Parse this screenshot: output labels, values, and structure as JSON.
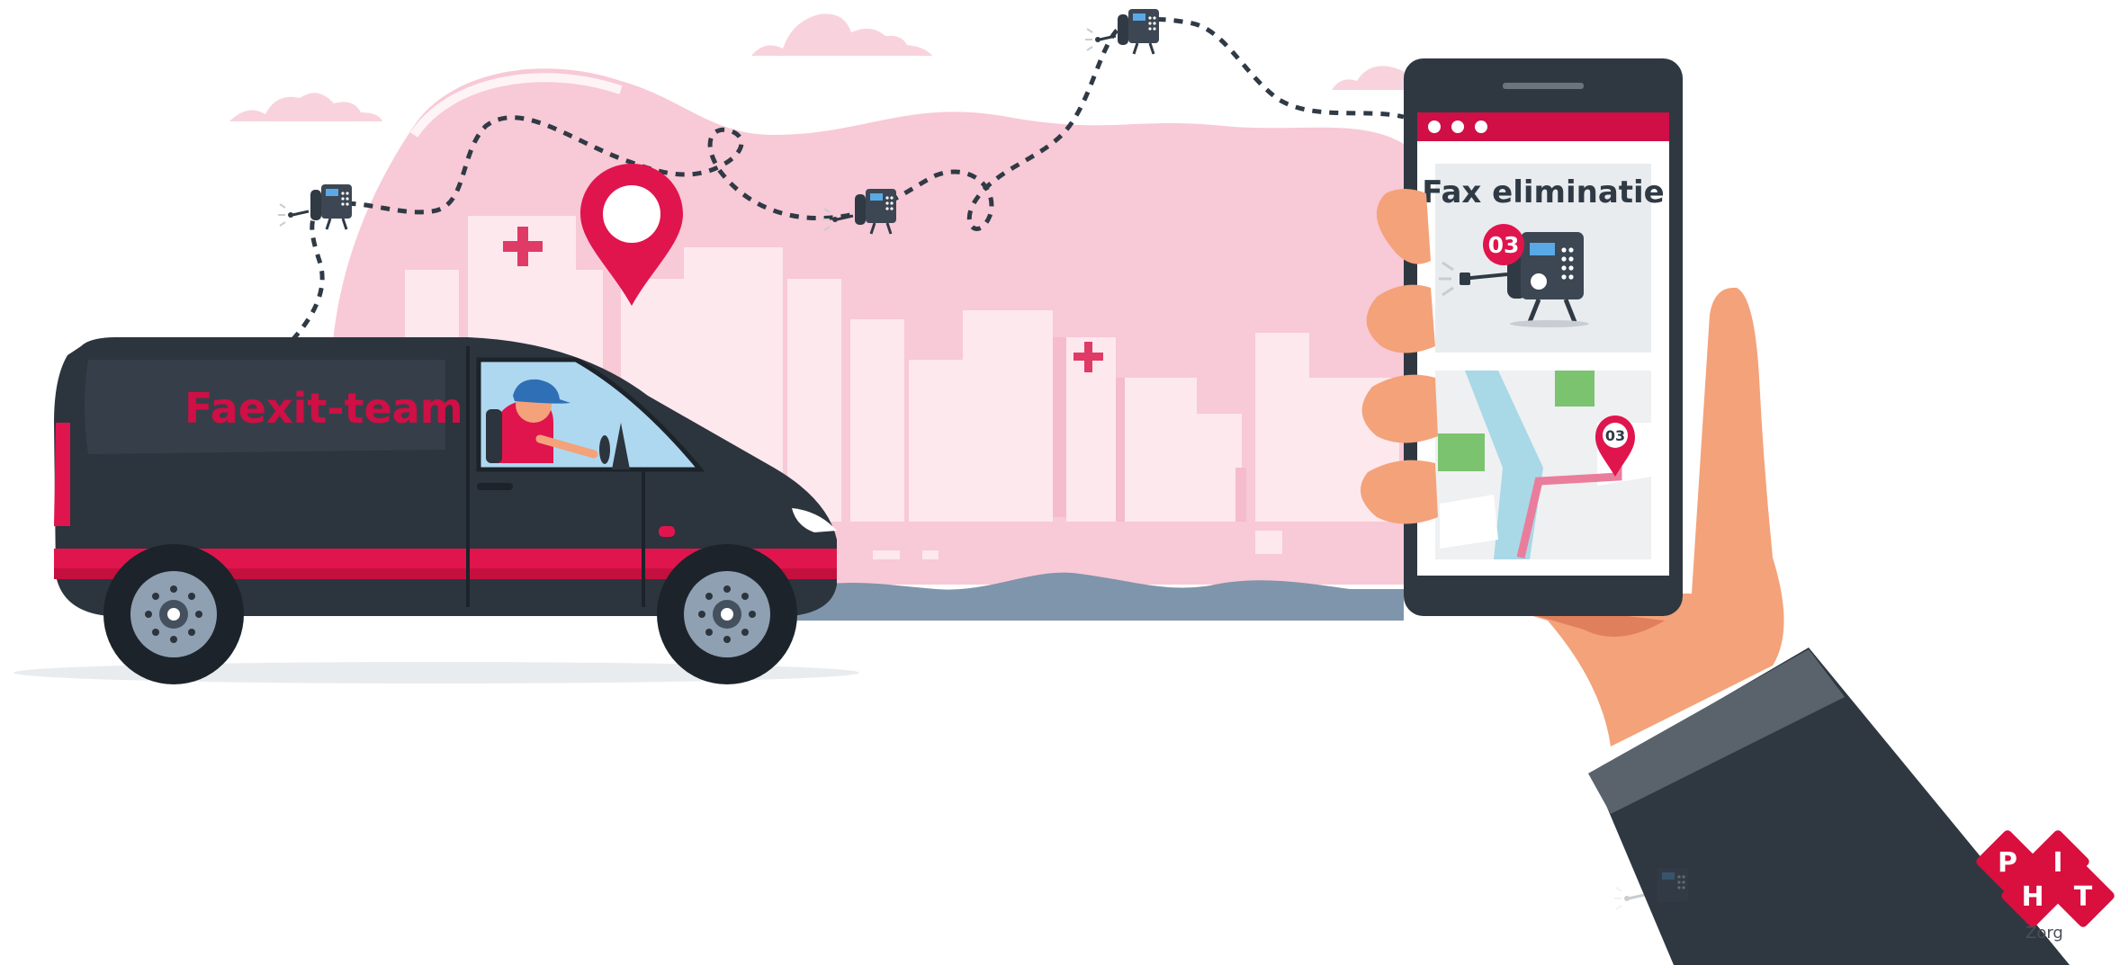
{
  "van": {
    "label": "Faexit-team"
  },
  "phone": {
    "app_title": "Fax eliminatie",
    "fax_badge": "03",
    "map_pin_label": "03"
  },
  "logo": {
    "letters": [
      "P",
      "H",
      "I",
      "T"
    ],
    "tagline_partial": "Zorg"
  },
  "colors": {
    "brand_red": "#cf0f45",
    "pink_bg": "#f8c9d6",
    "van_body": "#2c343d",
    "hand_skin": "#f4a27a",
    "sleeve": "#2f3841",
    "ground_wave": "#7f95ab"
  },
  "icons": [
    "fax-robot-icon",
    "location-pin-icon",
    "hospital-cross-icon",
    "cloud-icon"
  ]
}
